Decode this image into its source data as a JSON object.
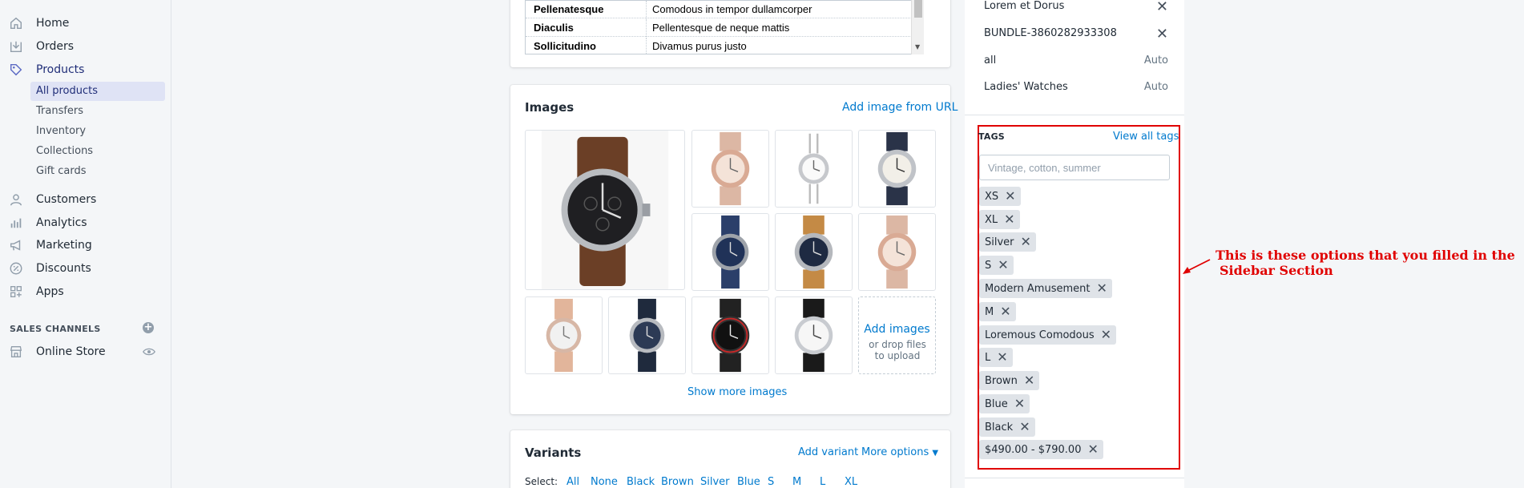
{
  "nav": {
    "home": "Home",
    "orders": "Orders",
    "products": "Products",
    "all_products": "All products",
    "transfers": "Transfers",
    "inventory": "Inventory",
    "collections": "Collections",
    "gift_cards": "Gift cards",
    "customers": "Customers",
    "analytics": "Analytics",
    "marketing": "Marketing",
    "discounts": "Discounts",
    "apps": "Apps",
    "sales_channels": "SALES CHANNELS",
    "online_store": "Online Store"
  },
  "attributes": [
    {
      "key": "Pellenatesque",
      "value": "Comodous in tempor dullamcorper"
    },
    {
      "key": "Diaculis",
      "value": "Pellentesque de neque mattis"
    },
    {
      "key": "Sollicitudino",
      "value": "Divamus purus justo"
    }
  ],
  "images_card": {
    "title": "Images",
    "add_from_url": "Add image from URL",
    "add_images": "Add images",
    "drop_hint": "or drop files to upload",
    "show_more": "Show more images"
  },
  "variants": {
    "title": "Variants",
    "add_variant": "Add variant",
    "more_options": "More options",
    "select_label": "Select:",
    "options": [
      "All",
      "None",
      "Black",
      "Brown",
      "Silver",
      "Blue",
      "S",
      "M",
      "L",
      "XL"
    ]
  },
  "organization": {
    "rows": [
      {
        "text": "Lorem et Dorus",
        "right": "✕"
      },
      {
        "text": "BUNDLE-3860282933308",
        "right": "✕"
      },
      {
        "text": "all",
        "right": "Auto"
      },
      {
        "text": "Ladies' Watches",
        "right": "Auto"
      }
    ]
  },
  "tags": {
    "title": "TAGS",
    "view_all": "View all tags",
    "placeholder": "Vintage, cotton, summer",
    "items": [
      "XS",
      "XL",
      "Silver",
      "S",
      "Modern Amusement",
      "M",
      "Loremous Comodous",
      "L",
      "Brown",
      "Blue",
      "Black",
      "$490.00 - $790.00"
    ]
  },
  "annotation": {
    "line1": "This is these options that you filled in the",
    "line2": "Sidebar Section"
  },
  "colors": {
    "accent": "#007ace",
    "highlight": "#e00000",
    "nav_active": "#202e78"
  }
}
